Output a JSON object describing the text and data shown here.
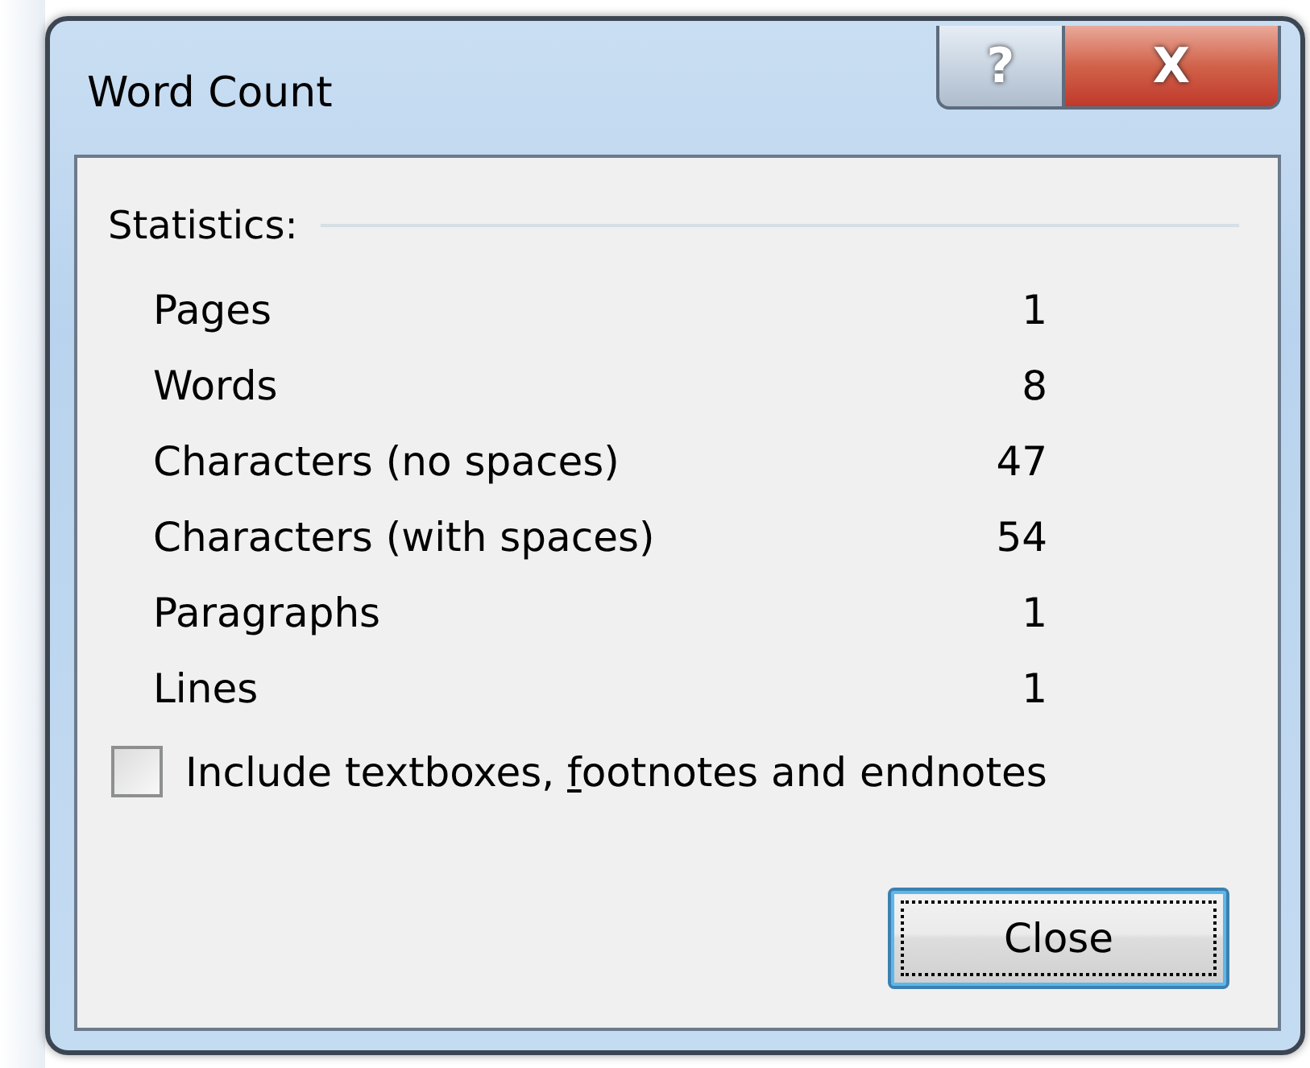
{
  "window": {
    "title": "Word Count",
    "help_button": "?",
    "close_button": "X"
  },
  "statistics": {
    "heading": "Statistics:",
    "rows": [
      {
        "label": "Pages",
        "value": "1"
      },
      {
        "label": "Words",
        "value": "8"
      },
      {
        "label": "Characters (no spaces)",
        "value": "47"
      },
      {
        "label": "Characters (with spaces)",
        "value": "54"
      },
      {
        "label": "Paragraphs",
        "value": "1"
      },
      {
        "label": "Lines",
        "value": "1"
      }
    ]
  },
  "option": {
    "label_before": "Include textboxes, ",
    "access_key": "f",
    "label_after": "ootnotes and endnotes",
    "checked": false
  },
  "buttons": [
    {
      "label": "Close",
      "focused": true
    }
  ]
}
